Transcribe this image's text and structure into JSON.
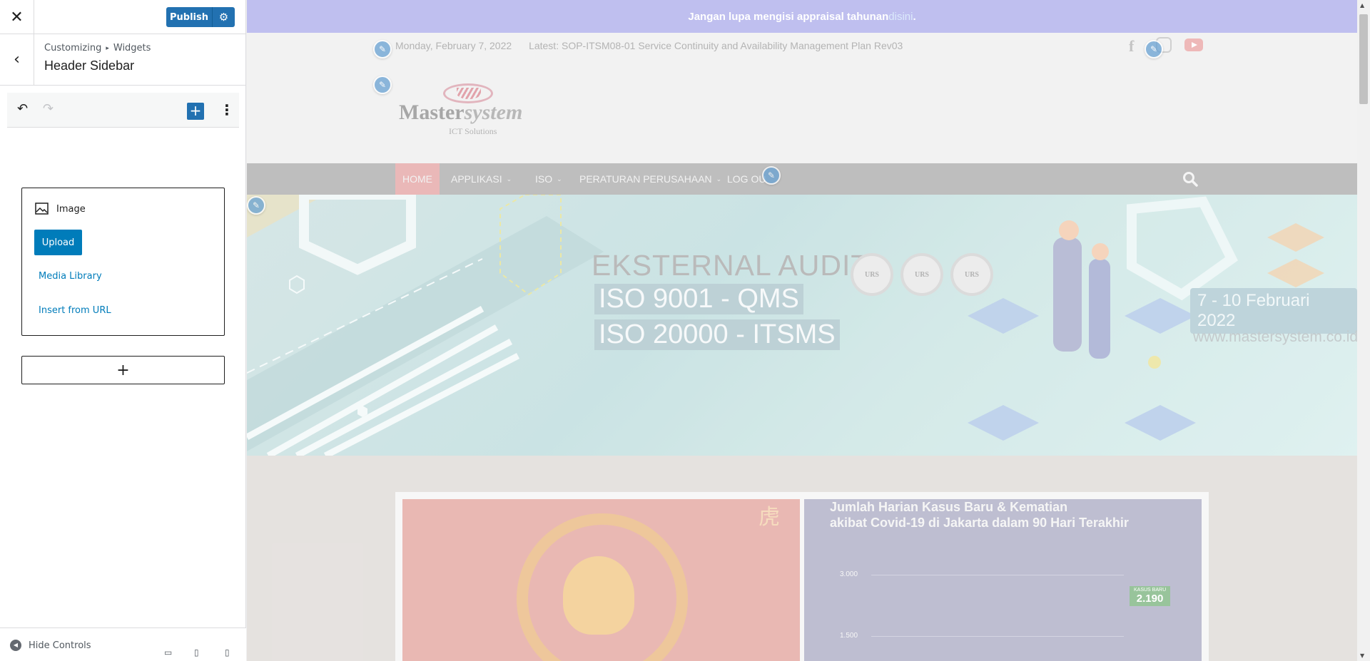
{
  "customizer": {
    "publish_label": "Publish",
    "breadcrumb": {
      "root": "Customizing",
      "sep": "▸",
      "section": "Widgets"
    },
    "section_title": "Header Sidebar",
    "image_block": {
      "label": "Image",
      "upload_label": "Upload",
      "media_library_label": "Media Library",
      "insert_url_label": "Insert from URL"
    },
    "add_widget_label": "+",
    "footer": {
      "hide_controls_label": "Hide Controls"
    },
    "accent_color": "#2271b1"
  },
  "site": {
    "notice": {
      "text": "Jangan lupa mengisi appraisal tahunan ",
      "link": "disini",
      "end": "."
    },
    "top_bar": {
      "date": "Monday, February 7, 2022",
      "latest": "Latest: SOP-ITSM08-01 Service Continuity and Availability Management Plan Rev03"
    },
    "social_icons": [
      "facebook-icon",
      "instagram-icon",
      "youtube-icon"
    ],
    "logo": {
      "name_part1": "Master",
      "name_part2": "system",
      "tagline": "ICT Solutions"
    },
    "nav": [
      {
        "label": "HOME",
        "dropdown": false
      },
      {
        "label": "APPLIKASI",
        "dropdown": true
      },
      {
        "label": "ISO",
        "dropdown": true
      },
      {
        "label": "PERATURAN PERUSAHAAN",
        "dropdown": true
      },
      {
        "label": "LOG OU",
        "dropdown": false
      }
    ],
    "banner": {
      "title": "EKSTERNAL AUDIT",
      "line1": "ISO 9001    - QMS",
      "line2": "ISO 20000 - ITSMS",
      "seal_label": "URS",
      "date": "7 - 10 Februari 2022",
      "website": "www.mastersystem.co.id"
    },
    "cards": {
      "cny_char": "虎",
      "covid_title_line1": "Jumlah Harian Kasus Baru &  Kematian",
      "covid_title_line2": "akibat Covid-19 di Jakarta dalam 90 Hari Terakhir",
      "tick_high": "3.000",
      "tick_low": "1.500",
      "badge_label": "KASUS BARU",
      "badge_value": "2.190"
    },
    "colors": {
      "notice_bg": "#aaaaea",
      "nav_bg": "#a9a9a9",
      "nav_active": "#e3a0a0"
    }
  }
}
